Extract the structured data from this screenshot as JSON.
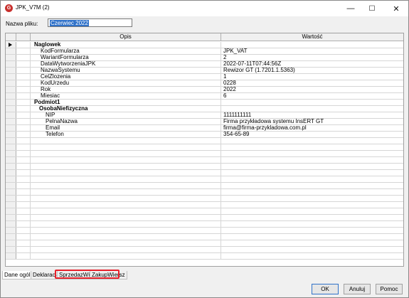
{
  "window": {
    "title": "JPK_V7M (2)",
    "minimize": "—",
    "maximize": "☐",
    "close": "✕"
  },
  "filename": {
    "label": "Nazwa pliku:",
    "value": "Czerwiec 2022"
  },
  "grid": {
    "col_desc": "Opis",
    "col_value": "Wartość",
    "rows": [
      {
        "kind": "group",
        "indent": 0,
        "name": "Naglowek",
        "value": ""
      },
      {
        "kind": "field",
        "indent": 1,
        "name": "KodFormularza",
        "value": "JPK_VAT"
      },
      {
        "kind": "field",
        "indent": 1,
        "name": "WariantFormularza",
        "value": "2"
      },
      {
        "kind": "field",
        "indent": 1,
        "name": "DataWytworzeniaJPK",
        "value": "2022-07-11T07:44:56Z"
      },
      {
        "kind": "field",
        "indent": 1,
        "name": "NazwaSystemu",
        "value": "Rewizor GT (1.7201.1.5363)"
      },
      {
        "kind": "field",
        "indent": 1,
        "name": "CelZlozenia",
        "value": "1"
      },
      {
        "kind": "field",
        "indent": 1,
        "name": "KodUrzedu",
        "value": "0228"
      },
      {
        "kind": "field",
        "indent": 1,
        "name": "Rok",
        "value": "2022"
      },
      {
        "kind": "field",
        "indent": 1,
        "name": "Miesiac",
        "value": "6"
      },
      {
        "kind": "group",
        "indent": 0,
        "name": "Podmiot1",
        "value": ""
      },
      {
        "kind": "subgroup",
        "indent": 1,
        "name": "OsobaNiefizyczna",
        "value": ""
      },
      {
        "kind": "field",
        "indent": 2,
        "name": "NIP",
        "value": "1111111111"
      },
      {
        "kind": "field",
        "indent": 2,
        "name": "PelnaNazwa",
        "value": "Firma przykładowa systemu InsERT GT"
      },
      {
        "kind": "field",
        "indent": 2,
        "name": "Email",
        "value": "firma@firma-przykladowa.com.pl"
      },
      {
        "kind": "field",
        "indent": 2,
        "name": "Telefon",
        "value": "354-65-89"
      }
    ]
  },
  "tabs": [
    "Dane ogólne",
    "Deklaracja",
    "SprzedazWiersz",
    "ZakupWiersz"
  ],
  "buttons": {
    "ok": "OK",
    "cancel": "Anuluj",
    "print": "Pomoc"
  }
}
